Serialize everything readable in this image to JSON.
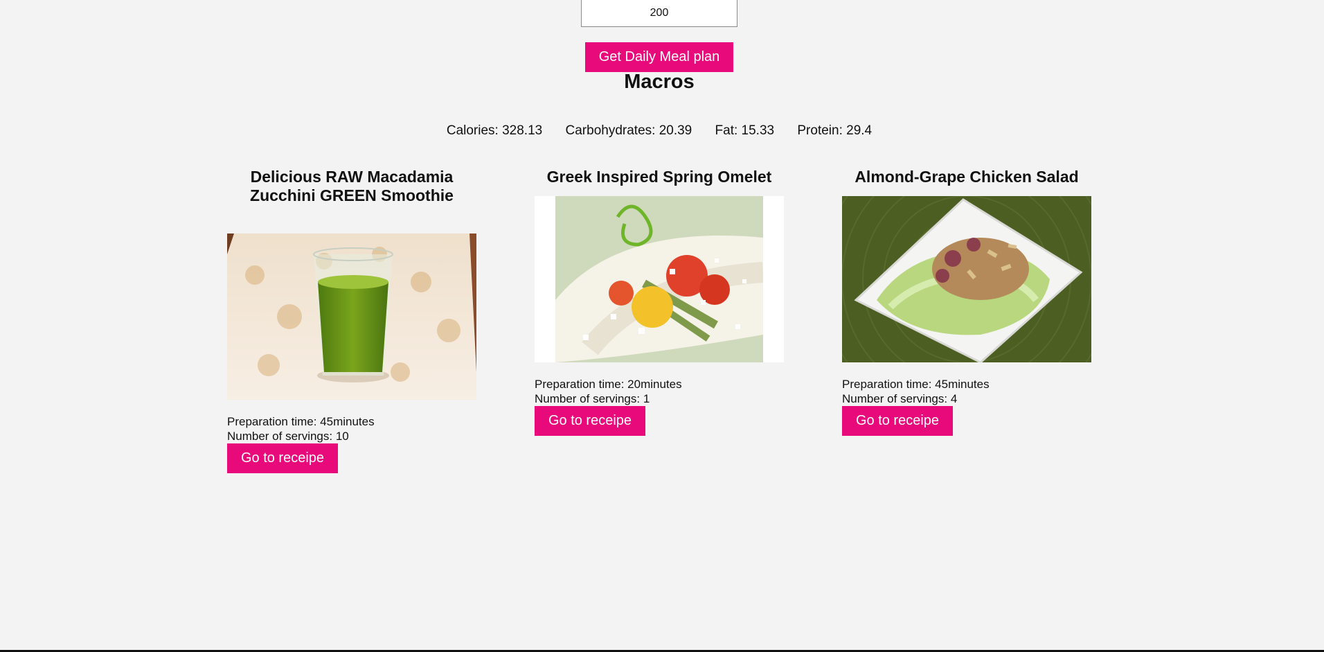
{
  "form": {
    "calorie_value": "200",
    "submit_label": "Get Daily Meal plan"
  },
  "macros": {
    "title": "Macros",
    "calories": "Calories: 328.13",
    "carbohydrates": "Carbohydrates: 20.39",
    "fat": "Fat: 15.33",
    "protein": "Protein: 29.4"
  },
  "meals": [
    {
      "title": "Delicious RAW Macadamia Zucchini GREEN Smoothie",
      "image": "green-smoothie-glass-photo",
      "prep_time": "Preparation time: 45minutes",
      "servings": "Number of servings: 10",
      "button_label": "Go to receipe"
    },
    {
      "title": "Greek Inspired Spring Omelet",
      "image": "omelet-with-tomatoes-photo",
      "prep_time": "Preparation time: 20minutes",
      "servings": "Number of servings: 1",
      "button_label": "Go to receipe"
    },
    {
      "title": "Almond-Grape Chicken Salad",
      "image": "chicken-salad-lettuce-photo",
      "prep_time": "Preparation time: 45minutes",
      "servings": "Number of servings: 4",
      "button_label": "Go to receipe"
    }
  ],
  "colors": {
    "background": "#f3f3f3",
    "accent": "#e8097a"
  }
}
